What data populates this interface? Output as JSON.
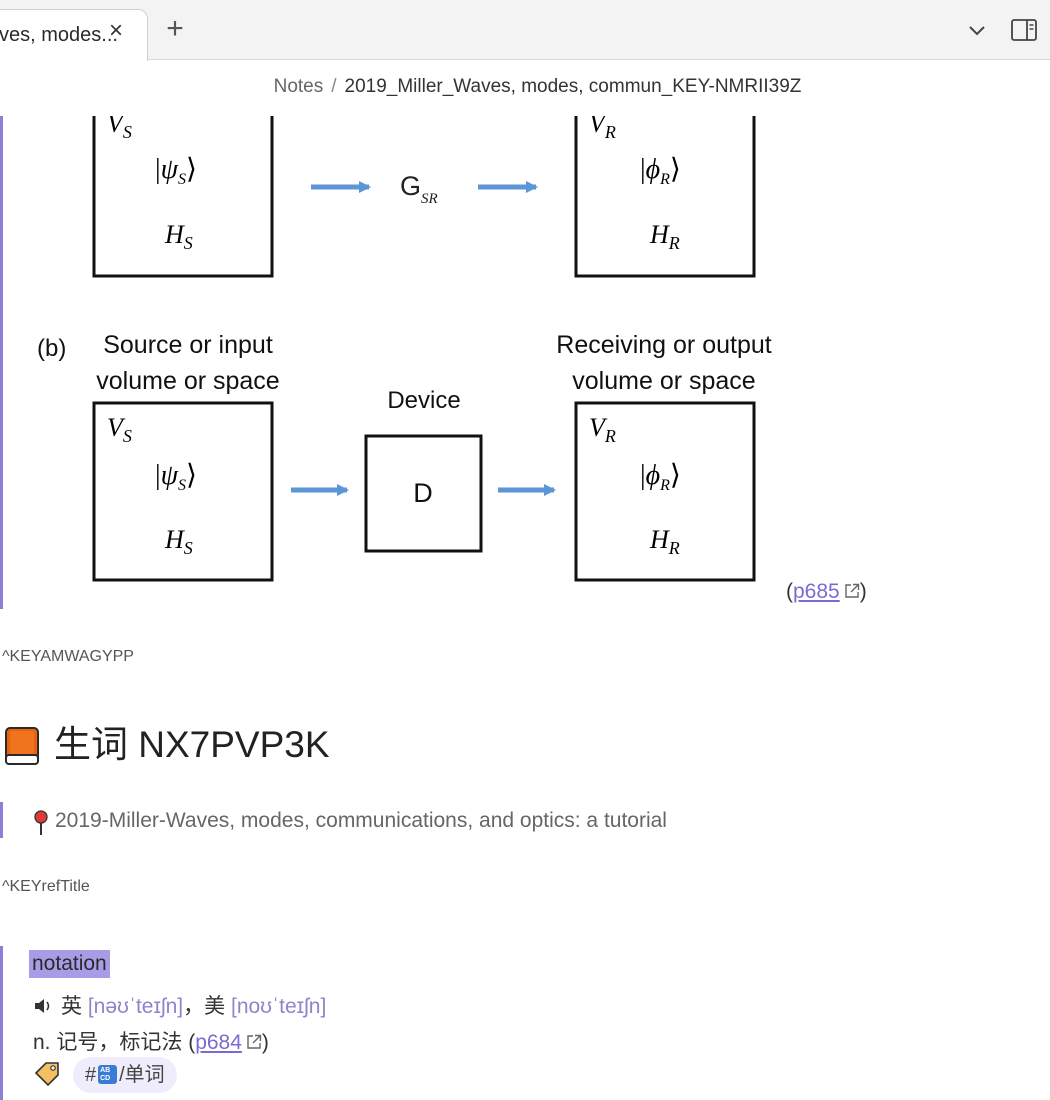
{
  "tab": {
    "title": "ves, modes...",
    "close": "×",
    "new_tab": "+"
  },
  "breadcrumb": {
    "root": "Notes",
    "separator": "/",
    "current": "2019_Miller_Waves, modes, commun_KEY-NMRII39Z"
  },
  "figure": {
    "top_row": {
      "source_volume": "V",
      "source_volume_sub": "S",
      "source_ket": "ψ",
      "source_ket_sub": "S",
      "source_space": "H",
      "source_space_sub": "S",
      "operator": "G",
      "operator_sub": "SR",
      "recv_volume": "V",
      "recv_volume_sub": "R",
      "recv_ket": "ϕ",
      "recv_ket_sub": "R",
      "recv_space": "H",
      "recv_space_sub": "R"
    },
    "bottom_row": {
      "panel_label": "(b)",
      "source_caption_1": "Source or input",
      "source_caption_2": "volume or space",
      "device_caption": "Device",
      "device_label": "D",
      "recv_caption_1": "Receiving or output",
      "recv_caption_2": "volume or space"
    },
    "arrow_color": "#5b96d6"
  },
  "figure_page_link": "p685",
  "block_id_1": "^KEYAMWAGYPP",
  "heading": {
    "title": "生词 NX7PVP3K",
    "icon": "orange-book-icon"
  },
  "reference": {
    "icon": "round-pushpin-icon",
    "text": "2019-Miller-Waves, modes, communications, and optics: a tutorial"
  },
  "block_id_2": "^KEYrefTitle",
  "vocab": {
    "word": "notation",
    "uk_label": "英",
    "uk_ipa": "[nəʊˈteɪʃn]",
    "separator": "，",
    "us_label": "美",
    "us_ipa": "[noʊˈteɪʃn]",
    "meaning": "n. 记号，标记法",
    "meaning_link": "p684",
    "tag_prefix": "#",
    "tag_suffix": "/单词"
  },
  "colors": {
    "accent": "#8f7fd6",
    "link": "#7b6bd0",
    "highlight": "#a99ce6"
  }
}
